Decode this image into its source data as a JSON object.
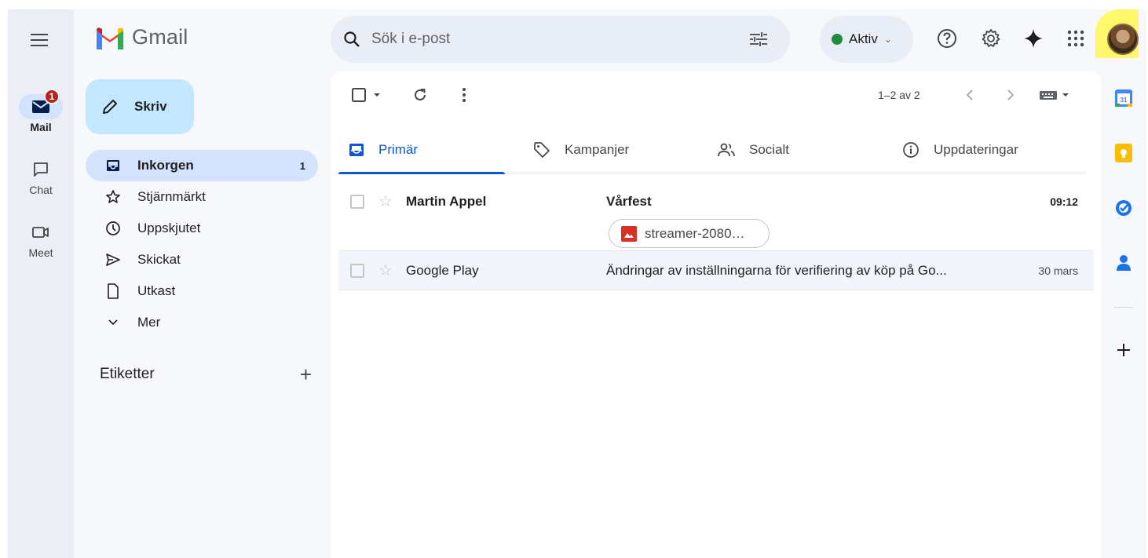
{
  "rail": {
    "items": [
      {
        "label": "Mail",
        "badge": "1"
      },
      {
        "label": "Chat"
      },
      {
        "label": "Meet"
      }
    ]
  },
  "app": {
    "name": "Gmail"
  },
  "compose": {
    "label": "Skriv"
  },
  "nav": {
    "items": [
      {
        "label": "Inkorgen",
        "count": "1"
      },
      {
        "label": "Stjärnmärkt"
      },
      {
        "label": "Uppskjutet"
      },
      {
        "label": "Skickat"
      },
      {
        "label": "Utkast"
      },
      {
        "label": "Mer"
      }
    ]
  },
  "labels": {
    "title": "Etiketter"
  },
  "search": {
    "placeholder": "Sök i e-post"
  },
  "status": {
    "label": "Aktiv",
    "color": "#1e8e3e"
  },
  "toolbar": {
    "pager": "1–2 av 2"
  },
  "tabs": [
    {
      "label": "Primär"
    },
    {
      "label": "Kampanjer"
    },
    {
      "label": "Socialt"
    },
    {
      "label": "Uppdateringar"
    }
  ],
  "emails": [
    {
      "sender": "Martin Appel",
      "subject": "Vårfest",
      "time": "09:12",
      "attachment": "streamer-2080…"
    },
    {
      "sender": "Google Play",
      "subject": "Ändringar av inställningarna för verifiering av köp på Go...",
      "time": "30 mars"
    }
  ],
  "colors": {
    "accent": "#0b57d0",
    "compose": "#c2e7ff",
    "active_nav": "#d3e3fd",
    "badge": "#b3261e"
  }
}
